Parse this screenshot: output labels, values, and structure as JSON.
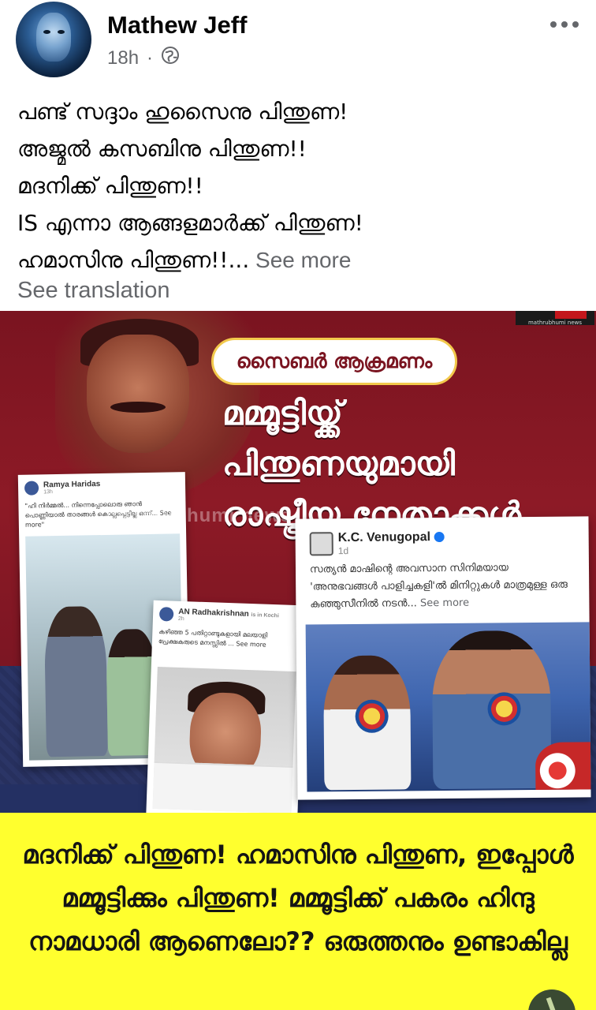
{
  "post": {
    "author": "Mathew Jeff",
    "time": "18h",
    "separator": "·",
    "privacy_icon": "globe-icon",
    "text_lines": [
      "പണ്ട് സദ്ദാം ഹുസൈനു പിന്തുണ!",
      "അജ്മൽ കസബിനു പിന്തുണ!!",
      "മദനിക്ക് പിന്തുണ!!",
      "IS എന്നാ ആങ്ങളമാർക്ക് പിന്തുണ!",
      "ഹമാസിനു പിന്തുണ!!..."
    ],
    "see_more": " See more",
    "see_translation": "See translation"
  },
  "image": {
    "headline_pill": "സൈബർ ആക്രമണം",
    "headline_lines": [
      "മമ്മൂട്ടിയ്ക്ക്",
      "പിന്തുണയുമായി",
      "രാഷ്ട്രീയ നേതാക്കൾ"
    ],
    "watermark": "mathrubhumi news",
    "channel_logo": "mathrubhumi news",
    "shot_a": {
      "name": "Ramya Haridas",
      "time": "13h",
      "text": "\"ഹി നിർമ്മൽ... നിന്നെപ്പോലൊരു ഞാൻ പൊണ്ണിയാൽ താരങ്ങൾ കൊല്ലപ്പെട്ടില്ല ഒന്ന്... See more\""
    },
    "shot_b": {
      "name": "AN Radhakrishnan",
      "location": "is in Kochi",
      "time": "2h",
      "text": "കഴിഞ്ഞ 5 പതിറ്റാണ്ടുകളായി മലയാളി പ്രേക്ഷകരുടെ മനസ്സിൽ ... See more"
    },
    "shot_c": {
      "name": "K.C. Venugopal",
      "time": "1d",
      "text": "സത്യൻ മാഷിന്റെ അവസാന സിനിമയായ 'അനുഭവങ്ങൾ പാളിച്ചകളി'ൽ മിനിറ്റുകൾ മാത്രമുള്ള ഒരു കുഞ്ഞുസീനിൽ നടൻ...",
      "see_more": " See more"
    },
    "caption": "മദനിക്ക് പിന്തുണ! ഹമാസിനു പിന്തുണ, ഇപ്പോൾ മമ്മൂട്ടിക്കും പിന്തുണ! മമ്മൂട്ടിക്ക് പകരം ഹിന്ദു നാമധാരി ആണെലോ?? ഒരുത്തനും ഉണ്ടാകില്ല"
  },
  "colors": {
    "caption_bg": "#ffff2e",
    "banner_red": "#7a1420",
    "navy": "#2b3566",
    "meta_gray": "#65676b"
  }
}
